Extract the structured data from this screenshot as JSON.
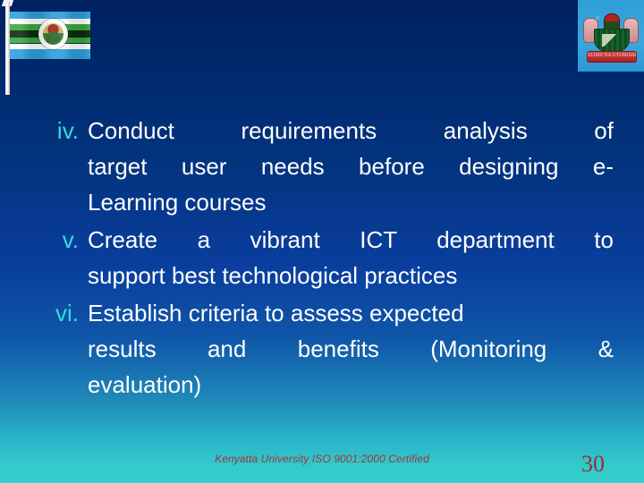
{
  "slide": {
    "background_top_color": "#002060",
    "background_mid_color": "#0a3e9e",
    "background_bottom_color": "#33cccc",
    "marker_color": "#33dede",
    "text_color": "#ffffff",
    "footer_color": "#a4323c"
  },
  "flag": {
    "name": "Kenyatta University flag",
    "stripes": [
      "#2f9fdc",
      "#ffffff",
      "#3aa83a",
      "#0c2b10",
      "#3aa83a",
      "#ffffff",
      "#2f9fdc"
    ]
  },
  "crest": {
    "name": "Kenyatta University coat of arms",
    "motto": "ELIMU NA UTUMISHI",
    "background_color": "#2f9fd8"
  },
  "list": {
    "items": [
      {
        "marker": "iv.",
        "lines": [
          "Conduct requirements analysis of",
          "target user needs before designing e-",
          "Learning courses"
        ],
        "text": "Conduct requirements analysis of target user needs before designing e-Learning courses"
      },
      {
        "marker": "v.",
        "lines": [
          "Create a vibrant ICT department to",
          "support best technological practices"
        ],
        "text": "Create a vibrant ICT department to support best technological practices"
      },
      {
        "marker": "vi.",
        "lines": [
          "Establish criteria to assess expected",
          "results and benefits (Monitoring &",
          "evaluation)"
        ],
        "text": "Establish criteria to assess expected results and benefits (Monitoring & evaluation)"
      }
    ]
  },
  "footer": {
    "note": "Kenyatta University ISO 9001:2000 Certified",
    "page_number": "30"
  }
}
